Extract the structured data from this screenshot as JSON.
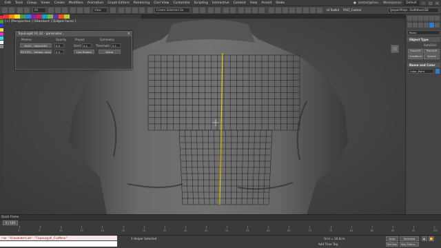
{
  "menubar": {
    "items": [
      "Edit",
      "Tools",
      "Group",
      "Views",
      "Create",
      "Modifiers",
      "Animation",
      "Graph Editors",
      "Rendering",
      "Civil View",
      "Customize",
      "Scripting",
      "Interactive",
      "Content",
      "Help",
      "Arnold",
      "Stoke"
    ],
    "user": "contact@ihoc...",
    "workspaces_label": "Workspaces:",
    "workspace": "Default"
  },
  "toolbar": {
    "selection_set": "Create Selection Se",
    "ui_toolkit": "UI Toolkit",
    "fast_control": "FAST_Control",
    "project_path": "\\Jesper\\Proje...Outfatuns\\3D"
  },
  "viewport": {
    "label": "[+] [Perspective ] [Standard ] [Edged Faces ]"
  },
  "topologik": {
    "title": "TopoLogiK V1.32 - paramater...",
    "headers": [
      "Meshes",
      "Opacity",
      "Project",
      "Symmetry"
    ],
    "high_mesh": "HIGH - Object001",
    "retopo_mesh": "RETOPO - Retopo_mesh",
    "opacity_high": "0.5",
    "opacity_retopo": "0.5",
    "shell_label": "Shell:",
    "shell_value": "0.1",
    "threshold_label": "Threshold",
    "threshold_value": "0.1",
    "live_project": "Live Project",
    "mirror": "Mirror"
  },
  "command_panel": {
    "field": "Plane",
    "object_type": "Object Type",
    "autogrid": "AutoGrid",
    "buttons": [
      "PlaneGR",
      "PlaneGR",
      "AutoBend",
      "Sphere"
    ],
    "name_and_color": "Name and Color",
    "name_value": "Color_Paint"
  },
  "timeline": {
    "quick_frame": "Quick Frame",
    "frame_slider": "0 / 100",
    "ticks": [
      "0",
      "5",
      "10",
      "15",
      "20",
      "25",
      "30",
      "35",
      "40",
      "45",
      "50",
      "55",
      "60",
      "65",
      "70",
      "75",
      "80",
      "85",
      "90",
      "95",
      "100"
    ]
  },
  "status": {
    "maxscript": "run \"AlexanderLab\" \"TopoLogiK_FixMenu\"",
    "selected": "1 Helper Selected",
    "grid": "Grid = 10.0cm",
    "add_time_tag": "Add Time Tag",
    "auto_key": "Auto Key",
    "selected_dropdown": "Selected",
    "set_key": "Set Key",
    "key_filters": "Key Filters..."
  },
  "colors": {
    "topology_line": "#1a1a1a",
    "symmetry_line": "#e8c800",
    "accent": "#2f7fc6"
  }
}
